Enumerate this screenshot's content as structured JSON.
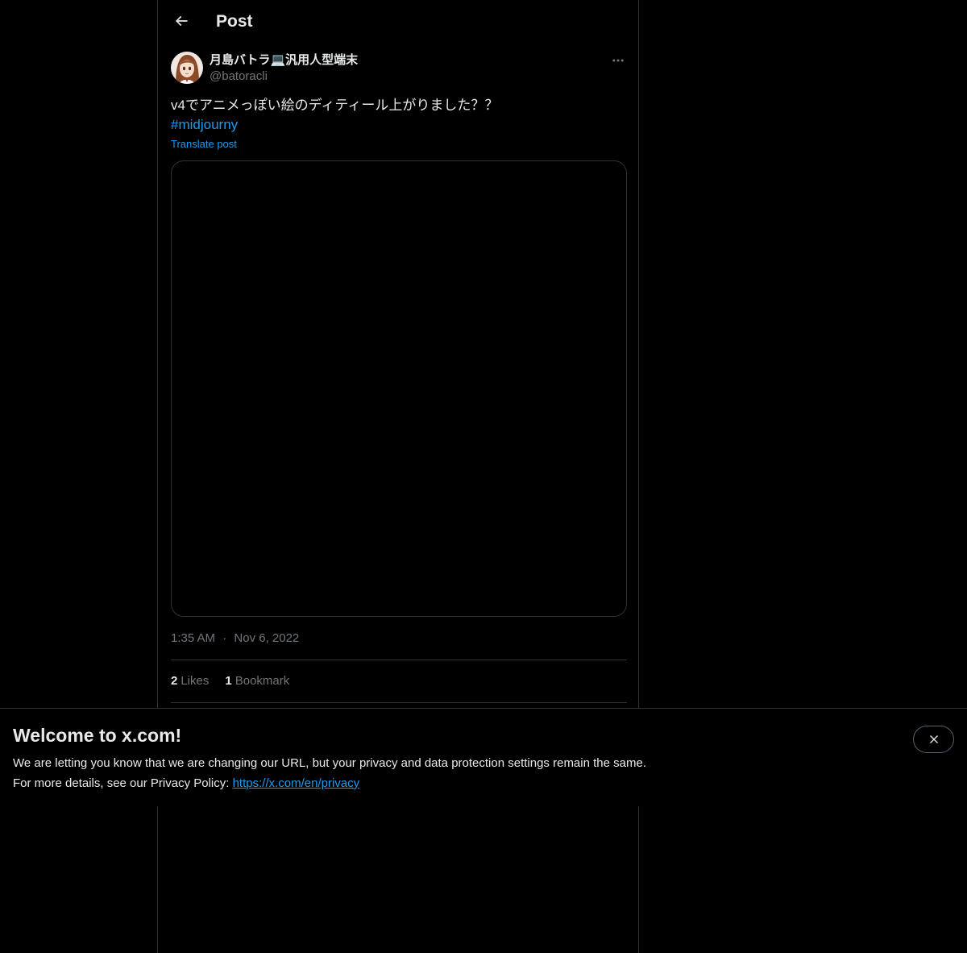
{
  "header": {
    "title": "Post"
  },
  "author": {
    "display_name": "月島バトラ💻汎用人型端末",
    "handle": "@batoracli"
  },
  "post": {
    "text": "v4でアニメっぽい絵のディティール上がりました？？",
    "hashtag": "#midjourny",
    "translate_label": "Translate post",
    "time": "1:35 AM",
    "separator": "·",
    "date": "Nov 6, 2022"
  },
  "stats": {
    "likes_count": "2",
    "likes_label": "Likes",
    "bookmarks_count": "1",
    "bookmarks_label": "Bookmark"
  },
  "banner": {
    "title": "Welcome to x.com!",
    "line1": "We are letting you know that we are changing our URL, but your privacy and data protection settings remain the same.",
    "line2_prefix": "For more details, see our Privacy Policy: ",
    "privacy_link": "https://x.com/en/privacy"
  },
  "icons": {
    "back": "arrow-left-icon",
    "more": "more-horizontal-icon",
    "close": "close-icon"
  },
  "colors": {
    "background": "#000000",
    "text": "#e7e9ea",
    "secondary_text": "#71767b",
    "accent": "#1d9bf0",
    "border": "#2f3336"
  }
}
